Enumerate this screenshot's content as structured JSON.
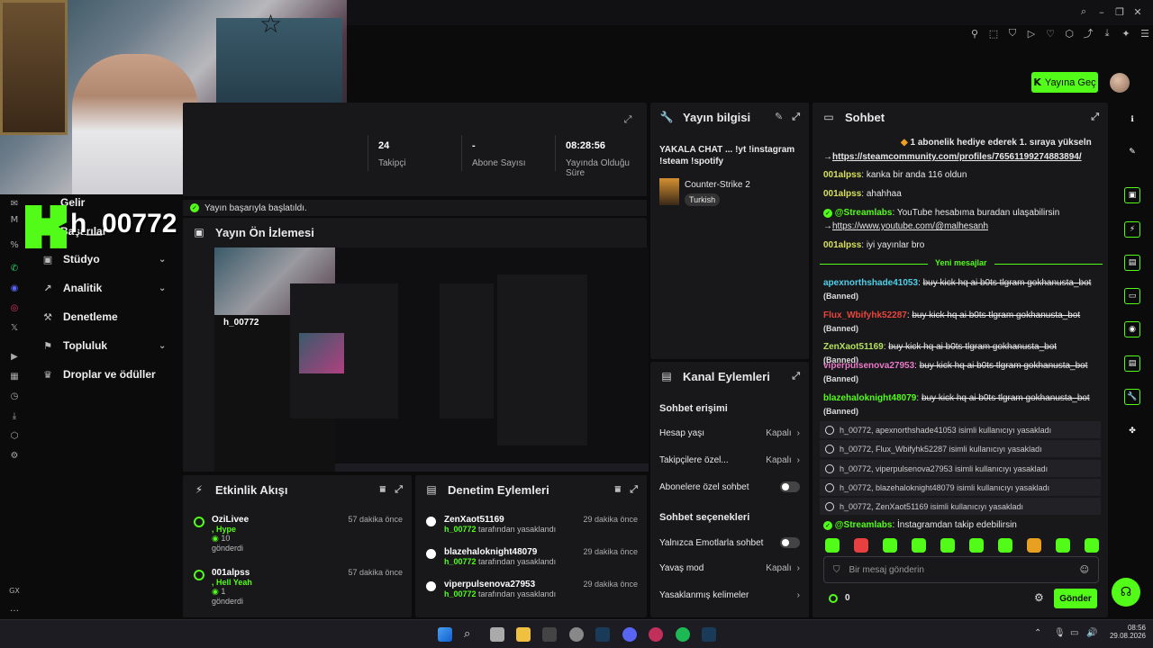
{
  "webcam": {
    "overlay_handle": "h_00772"
  },
  "nav": {
    "partial_top_1": "Gelir",
    "partial_top_2": "Başarılar",
    "items": [
      {
        "label": "Stüdyo",
        "has_chevron": true
      },
      {
        "label": "Analitik",
        "has_chevron": true
      },
      {
        "label": "Denetleme",
        "has_chevron": false
      },
      {
        "label": "Topluluk",
        "has_chevron": true
      },
      {
        "label": "Droplar ve ödüller",
        "has_chevron": false
      }
    ],
    "bottom_label": "GX"
  },
  "topbar": {
    "go_live": "Yayına Geç"
  },
  "stats": [
    {
      "value": "24",
      "label": "Takipçi"
    },
    {
      "value": "-",
      "label": "Abone Sayısı"
    },
    {
      "value": "08:28:56",
      "label": "Yayında Olduğu Süre"
    }
  ],
  "toast": "Yayın başarıyla başlatıldı.",
  "preview": {
    "title": "Yayın Ön İzlemesi"
  },
  "activity": {
    "title": "Etkinlik Akışı",
    "events": [
      {
        "user": "OziLivee",
        "time": "57 dakika önce",
        "message": ", Hype",
        "amount": "10",
        "action": "gönderdi"
      },
      {
        "user": "001alpss",
        "time": "57 dakika önce",
        "message": ", Hell Yeah",
        "amount": "1",
        "action": "gönderdi"
      }
    ]
  },
  "moderation": {
    "title": "Denetim Eylemleri",
    "items": [
      {
        "user": "ZenXaot51169",
        "time": "29 dakika önce",
        "by": "h_00772",
        "action": "tarafından yasaklandı"
      },
      {
        "user": "blazehaloknight48079",
        "time": "29 dakika önce",
        "by": "h_00772",
        "action": "tarafından yasaklandı"
      },
      {
        "user": "viperpulsenova27953",
        "time": "29 dakika önce",
        "by": "h_00772",
        "action": "tarafından yasaklandı"
      }
    ]
  },
  "stream_info": {
    "title": "Yayın bilgisi",
    "stream_title": "YAKALA CHAT ... !yt !instagram !steam !spotify",
    "category": "Counter-Strike 2",
    "language": "Turkish"
  },
  "channel_actions": {
    "title": "Kanal Eylemleri",
    "chat_access": "Sohbet erişimi",
    "account_age": {
      "label": "Hesap yaşı",
      "value": "Kapalı"
    },
    "followers_only": {
      "label": "Takipçilere özel...",
      "value": "Kapalı"
    },
    "subs_only": {
      "label": "Abonelere özel sohbet"
    },
    "chat_options": "Sohbet seçenekleri",
    "emotes_only": {
      "label": "Yalnızca Emotlarla sohbet"
    },
    "slow_mode": {
      "label": "Yavaş mod",
      "value": "Kapalı"
    },
    "banned_words": {
      "label": "Yasaklanmış kelimeler"
    }
  },
  "chat": {
    "title": "Sohbet",
    "gift_text": "1 abonelik hediye ederek 1. sıraya yükseln",
    "steam_link": "https://steamcommunity.com/profiles/76561199274883894/",
    "lines": [
      {
        "user": "001alpss",
        "text": ": kanka bir anda 116 oldun"
      },
      {
        "user": "001alpss",
        "text": ": ahahhaa"
      }
    ],
    "streamlabs_1": "@Streamlabs",
    "streamlabs_1_text": ": YouTube hesabıma buradan ulaşabilirsin",
    "youtube_link": "https://www.youtube.com/@malhesanh",
    "last_line_user": "001alpss",
    "last_line_text": ": iyi yayınlar bro",
    "new_messages": "Yeni mesajlar",
    "banned_msgs": [
      {
        "user": "apexnorthshade41053",
        "color": "#4fd0e8",
        "text": "buy kick hq ai b0ts tlgram gokhanusta_bot"
      },
      {
        "user": "Flux_Wbifyhk52287",
        "color": "#e8453c",
        "text": "buy kick hq ai b0ts tlgram gokhanusta_bot"
      },
      {
        "user": "ZenXaot51169",
        "color": "#b4e05a",
        "text": "buy kick hq ai b0ts tlgram gokhanusta_bot"
      },
      {
        "user": "viperpulsenova27953",
        "color": "#e87ac8",
        "text": "buy kick hq ai b0ts tlgram gokhanusta_bot"
      },
      {
        "user": "blazehaloknight48079",
        "color": "#53fc18",
        "text": "buy kick hq ai b0ts tlgram gokhanusta_bot"
      }
    ],
    "banned_label": "(Banned)",
    "ban_notices": [
      {
        "text": "h_00772, apexnorthshade41053 isimli kullanıcıyı yasakladı"
      },
      {
        "text": "h_00772, Flux_Wbifyhk52287 isimli kullanıcıyı yasakladı"
      },
      {
        "text": "h_00772, viperpulsenova27953 isimli kullanıcıyı yasakladı"
      },
      {
        "text": "h_00772, blazehaloknight48079 isimli kullanıcıyı yasakladı"
      },
      {
        "text": "h_00772, ZenXaot51169 isimli kullanıcıyı yasakladı"
      }
    ],
    "streamlabs_2": "@Streamlabs",
    "streamlabs_2_text": ": İnstagramdan takip edebilirsin",
    "input_placeholder": "Bir mesaj gönderin",
    "points": "0",
    "send": "Gönder"
  },
  "taskbar": {
    "time": "08:56",
    "date": "29.08.2026"
  },
  "colors": {
    "accent": "#53fc18",
    "panel": "#18181b",
    "bg": "#0b0b0c"
  }
}
